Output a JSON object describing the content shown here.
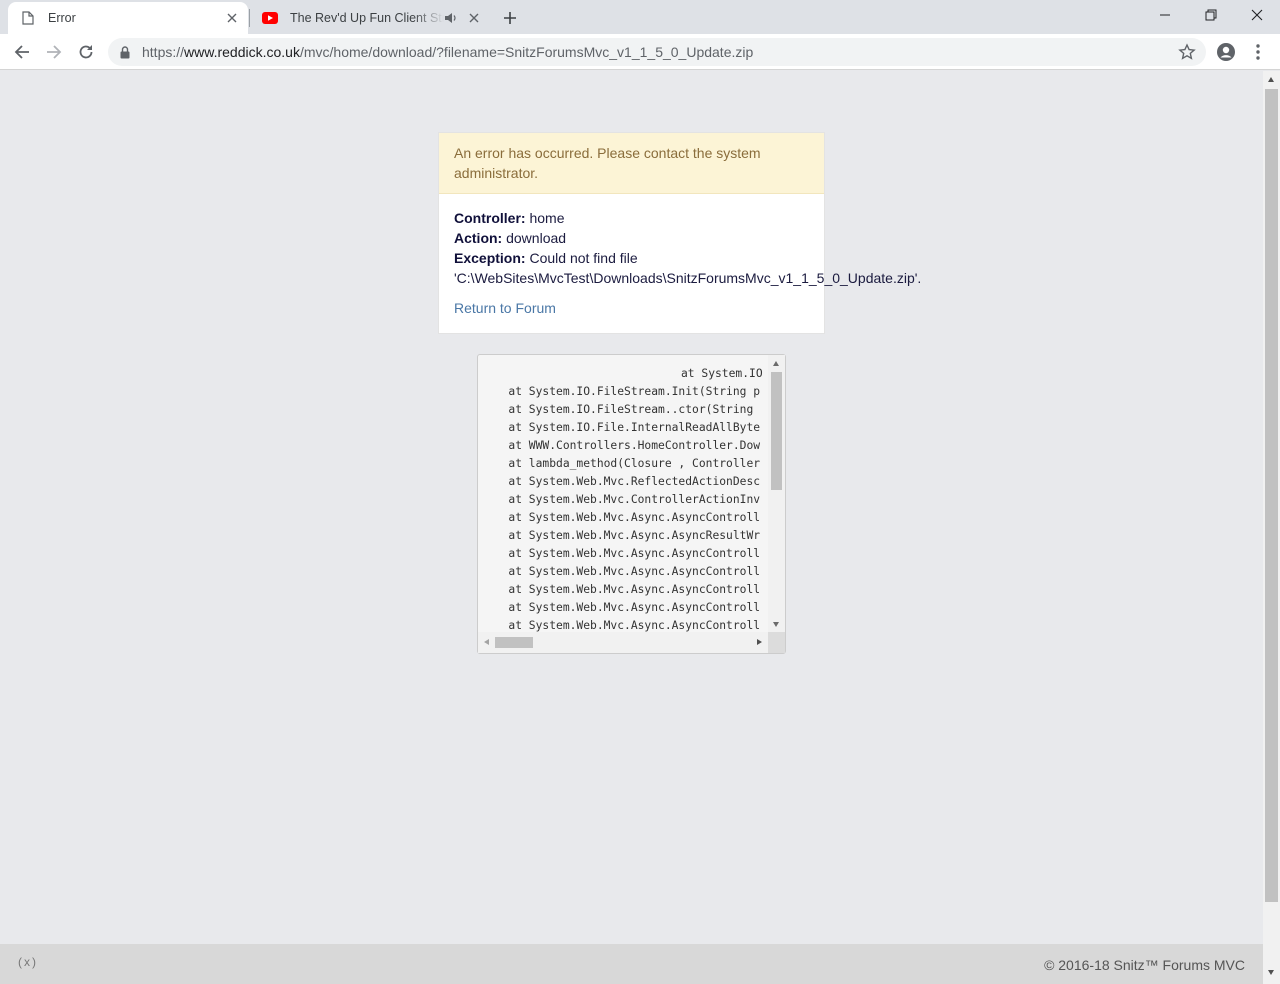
{
  "browser": {
    "tabs": [
      {
        "title": "Error",
        "active": true
      },
      {
        "title": "The Rev'd Up Fun Client Stru",
        "active": false
      }
    ],
    "url_prefix": "https://",
    "url_host": "www.reddick.co.uk",
    "url_path": "/mvc/home/download/?filename=SnitzForumsMvc_v1_1_5_0_Update.zip"
  },
  "error": {
    "message": "An error has occurred. Please contact the system administrator.",
    "controller_label": "Controller:",
    "controller_value": "home",
    "action_label": "Action:",
    "action_value": "download",
    "exception_label": "Exception:",
    "exception_value": "Could not find file",
    "exception_path": "'C:\\WebSites\\MvcTest\\Downloads\\SnitzForumsMvc_v1_1_5_0_Update.zip'.",
    "return_link": "Return to Forum"
  },
  "stack_trace": [
    "at System.IO",
    "   at System.IO.FileStream.Init(String p",
    "   at System.IO.FileStream..ctor(String",
    "   at System.IO.File.InternalReadAllByte",
    "   at WWW.Controllers.HomeController.Dow",
    "   at lambda_method(Closure , Controller",
    "   at System.Web.Mvc.ReflectedActionDesc",
    "   at System.Web.Mvc.ControllerActionInv",
    "   at System.Web.Mvc.Async.AsyncControll",
    "   at System.Web.Mvc.Async.AsyncResultWr",
    "   at System.Web.Mvc.Async.AsyncControll",
    "   at System.Web.Mvc.Async.AsyncControll",
    "   at System.Web.Mvc.Async.AsyncControll",
    "   at System.Web.Mvc.Async.AsyncControll",
    "   at System.Web.Mvc.Async.AsyncControll"
  ],
  "footer": {
    "left": "(x)",
    "right": "© 2016-18 Snitz™ Forums MVC"
  },
  "colors": {
    "alert_bg": "#fcf4d6",
    "alert_text": "#8a6d3b",
    "link": "#4a77a6",
    "youtube_red": "#ff0000"
  },
  "icons": [
    "page-icon",
    "youtube-icon",
    "speaker-icon",
    "close-icon",
    "plus-icon",
    "minimize-icon",
    "restore-icon",
    "back-icon",
    "forward-icon",
    "reload-icon",
    "lock-icon",
    "star-icon",
    "account-icon",
    "menu-icon"
  ]
}
